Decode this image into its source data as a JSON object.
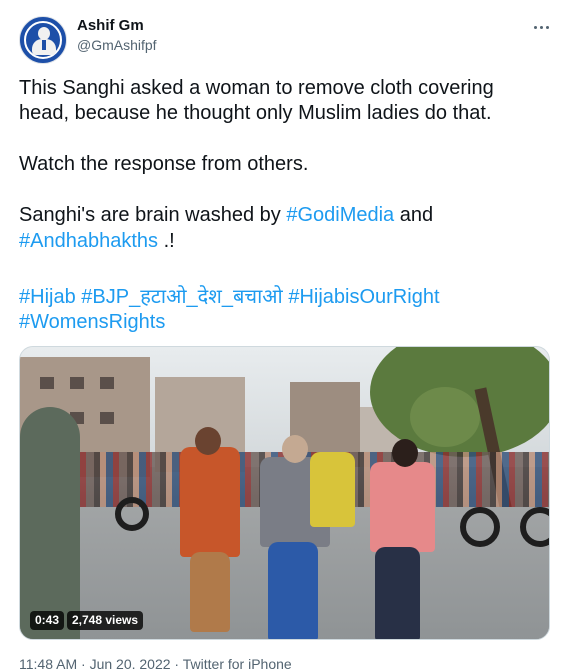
{
  "author": {
    "name": "Ashif Gm",
    "handle": "@GmAshifpf"
  },
  "tweet": {
    "line1": "This Sanghi asked a woman to remove cloth covering",
    "line2": "head, because he thought only Muslim ladies do that.",
    "line3": "Watch the response from others.",
    "line4_pre": "Sanghi's are brain washed by ",
    "line4_tag": "#GodiMedia",
    "line4_post": " and",
    "line5_tag": "#Andhabhakths",
    "line5_post": " .!",
    "hashtags_row1": [
      "#Hijab",
      "#BJP_हटाओ_देश_बचाओ",
      "#HijabisOurRight"
    ],
    "hashtags_row2": [
      "#WomensRights"
    ]
  },
  "media": {
    "duration": "0:43",
    "views": "2,748 views"
  },
  "meta": {
    "time": "11:48 AM",
    "separator1": " · ",
    "date": "Jun 20, 2022",
    "separator2": " · ",
    "source": "Twitter for iPhone"
  },
  "colors": {
    "link": "#1d9bf0",
    "secondary_text": "#536471",
    "primary_text": "#0f1419"
  },
  "icons": {
    "more": "more-dots-icon",
    "avatar": "profile-avatar"
  }
}
